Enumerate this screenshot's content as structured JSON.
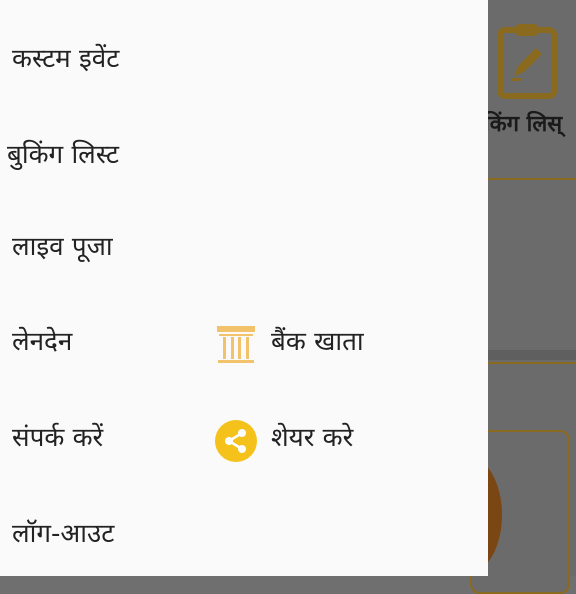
{
  "drawer": {
    "items": [
      {
        "label": "कस्टम इवेंट"
      },
      {
        "label": "बुकिंग लिस्ट"
      },
      {
        "label": "लाइव पूजा"
      },
      {
        "label": "लेनदेन"
      },
      {
        "label": "संपर्क करें"
      },
      {
        "label": "लॉग-आउट"
      }
    ],
    "secondary": [
      {
        "label": "बैंक खाता",
        "icon": "bank-icon"
      },
      {
        "label": "शेयर करे",
        "icon": "share-icon"
      }
    ]
  },
  "background": {
    "tile_label": "किंग लिस्"
  },
  "colors": {
    "accent": "#F4C21A",
    "bank_icon": "#F2C36A",
    "scrim": "#6b6b6b",
    "text": "#222222"
  }
}
